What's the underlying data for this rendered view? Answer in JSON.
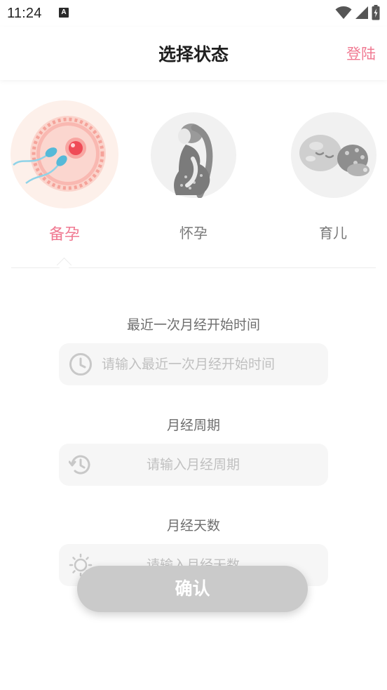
{
  "status_bar": {
    "time": "11:24",
    "notification_badge": "A",
    "icons": [
      "wifi-icon",
      "signal-icon",
      "battery-icon"
    ]
  },
  "header": {
    "title": "选择状态",
    "login_label": "登陆"
  },
  "states": {
    "items": [
      {
        "label": "备孕",
        "icon": "conception-icon",
        "selected": true
      },
      {
        "label": "怀孕",
        "icon": "pregnancy-icon",
        "selected": false
      },
      {
        "label": "育儿",
        "icon": "baby-care-icon",
        "selected": false
      }
    ]
  },
  "form": {
    "last_period": {
      "label": "最近一次月经开始时间",
      "placeholder": "请输入最近一次月经开始时间",
      "icon": "clock-icon"
    },
    "cycle": {
      "label": "月经周期",
      "placeholder": "请输入月经周期",
      "icon": "history-icon"
    },
    "days": {
      "label": "月经天数",
      "placeholder": "请输入月经天数",
      "icon": "sun-icon"
    }
  },
  "confirm_label": "确认",
  "colors": {
    "accent": "#f07a92",
    "selected_bg": "#fdf1ec",
    "button_disabled": "#cacaca",
    "field_bg": "#f6f6f6"
  }
}
